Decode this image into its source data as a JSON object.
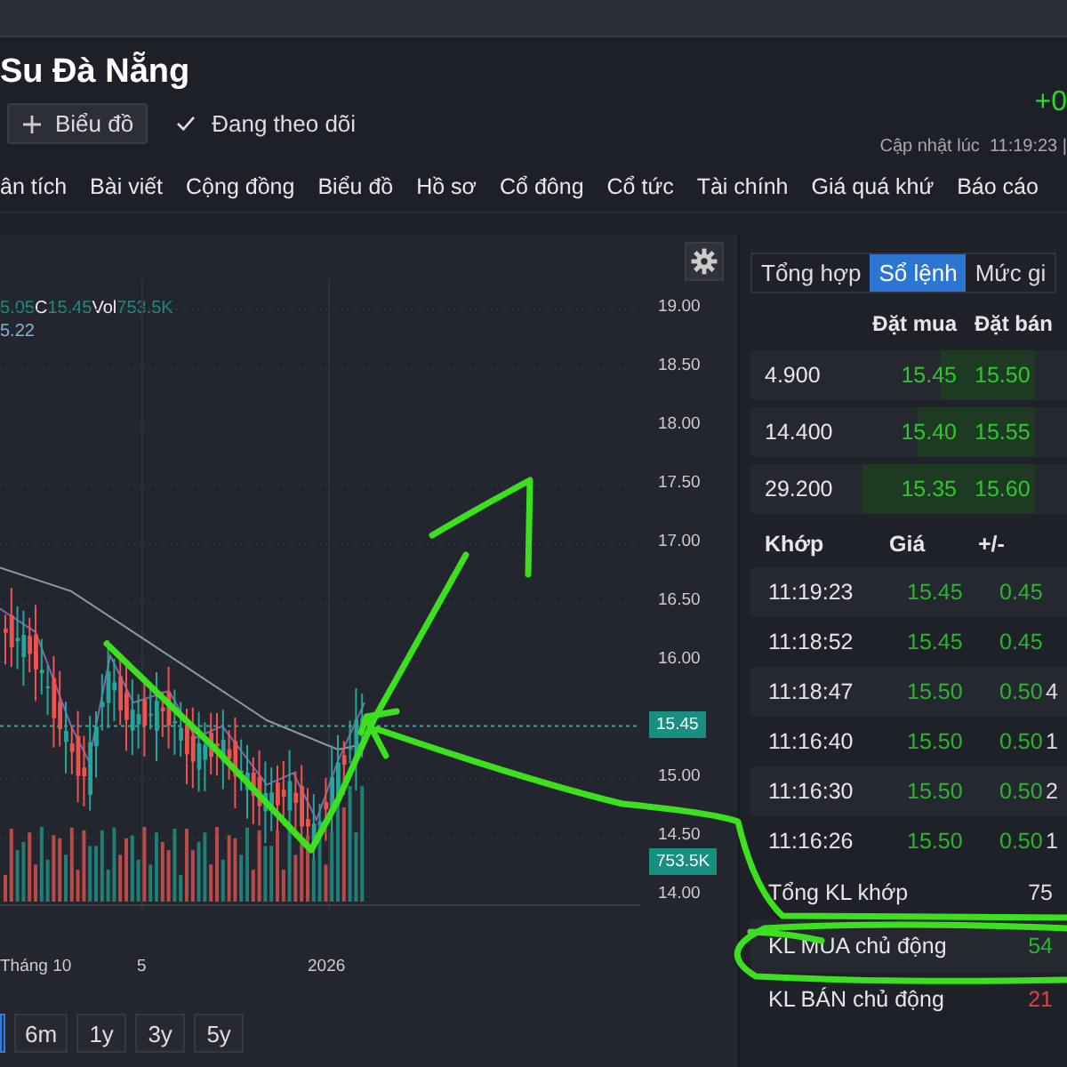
{
  "header": {
    "title": "Su Đà Nẵng",
    "change": "+0",
    "chart_button": "Biểu đồ",
    "follow_label": "Đang theo dõi",
    "updated": "Cập nhật lúc  11:19:23 |"
  },
  "nav": [
    {
      "label": "ân tích",
      "selected": false
    },
    {
      "label": "Bài viết",
      "selected": false
    },
    {
      "label": "Cộng đồng",
      "selected": false
    },
    {
      "label": "Biểu đồ",
      "selected": false
    },
    {
      "label": "Hồ sơ",
      "selected": false
    },
    {
      "label": "Cổ đông",
      "selected": false
    },
    {
      "label": "Cổ tức",
      "selected": false
    },
    {
      "label": "Tài chính",
      "selected": false
    },
    {
      "label": "Giá quá khứ",
      "selected": false
    },
    {
      "label": "Báo cáo",
      "selected": false
    }
  ],
  "chart": {
    "legend": [
      {
        "kind": "value",
        "text": "5.05"
      },
      {
        "kind": "label",
        "text": "C"
      },
      {
        "kind": "value",
        "text": "15.45"
      },
      {
        "kind": "label",
        "text": "Vol"
      },
      {
        "kind": "value",
        "text": "753.5K"
      }
    ],
    "ma_value": "5.22",
    "y_ticks": [
      "19.00",
      "18.50",
      "18.00",
      "17.50",
      "17.00",
      "16.50",
      "16.00",
      "15.00",
      "14.50",
      "14.00"
    ],
    "price_tag": "15.45",
    "volume_tag": "753.5K",
    "x_labels": [
      "Tháng 10",
      "5",
      "2026"
    ],
    "ranges": [
      {
        "selected": true
      },
      {
        "label": "6m",
        "selected": false
      },
      {
        "label": "1y",
        "selected": false
      },
      {
        "label": "3y",
        "selected": false
      },
      {
        "label": "5y",
        "selected": false
      }
    ]
  },
  "panel": {
    "tabs": [
      {
        "label": "Tổng hợp",
        "selected": false
      },
      {
        "label": "Sổ lệnh",
        "selected": true
      },
      {
        "label": "Mức gi",
        "selected": false
      }
    ],
    "book_headers": [
      "Đặt mua",
      "Đặt bán"
    ],
    "book": [
      {
        "volume": "4.900",
        "bid": "15.45",
        "ask": "15.50",
        "level": 0.25
      },
      {
        "volume": "14.400",
        "bid": "15.40",
        "ask": "15.55",
        "level": 0.45
      },
      {
        "volume": "29.200",
        "bid": "15.35",
        "ask": "15.60",
        "level": 0.95
      }
    ],
    "trade_headers": [
      "Khớp",
      "Giá",
      "+/-"
    ],
    "trades": [
      {
        "time": "11:19:23",
        "price": "15.45",
        "change": "0.45"
      },
      {
        "time": "11:18:52",
        "price": "15.45",
        "change": "0.45"
      },
      {
        "time": "11:18:47",
        "price": "15.50",
        "change": "0.50",
        "column_4": "4"
      },
      {
        "time": "11:16:40",
        "price": "15.50",
        "change": "0.50",
        "column_4": "1"
      },
      {
        "time": "11:16:30",
        "price": "15.50",
        "change": "0.50",
        "column_4": "2"
      },
      {
        "time": "11:16:26",
        "price": "15.50",
        "change": "0.50",
        "column_4": "1"
      }
    ],
    "summary": [
      {
        "kind": "total",
        "label": "Tổng KL khớp",
        "value": "75"
      },
      {
        "kind": "buy",
        "label": "KL MUA chủ động",
        "value": "54"
      },
      {
        "kind": "sell",
        "label": "KL BÁN chủ động",
        "value": "21"
      }
    ]
  }
}
